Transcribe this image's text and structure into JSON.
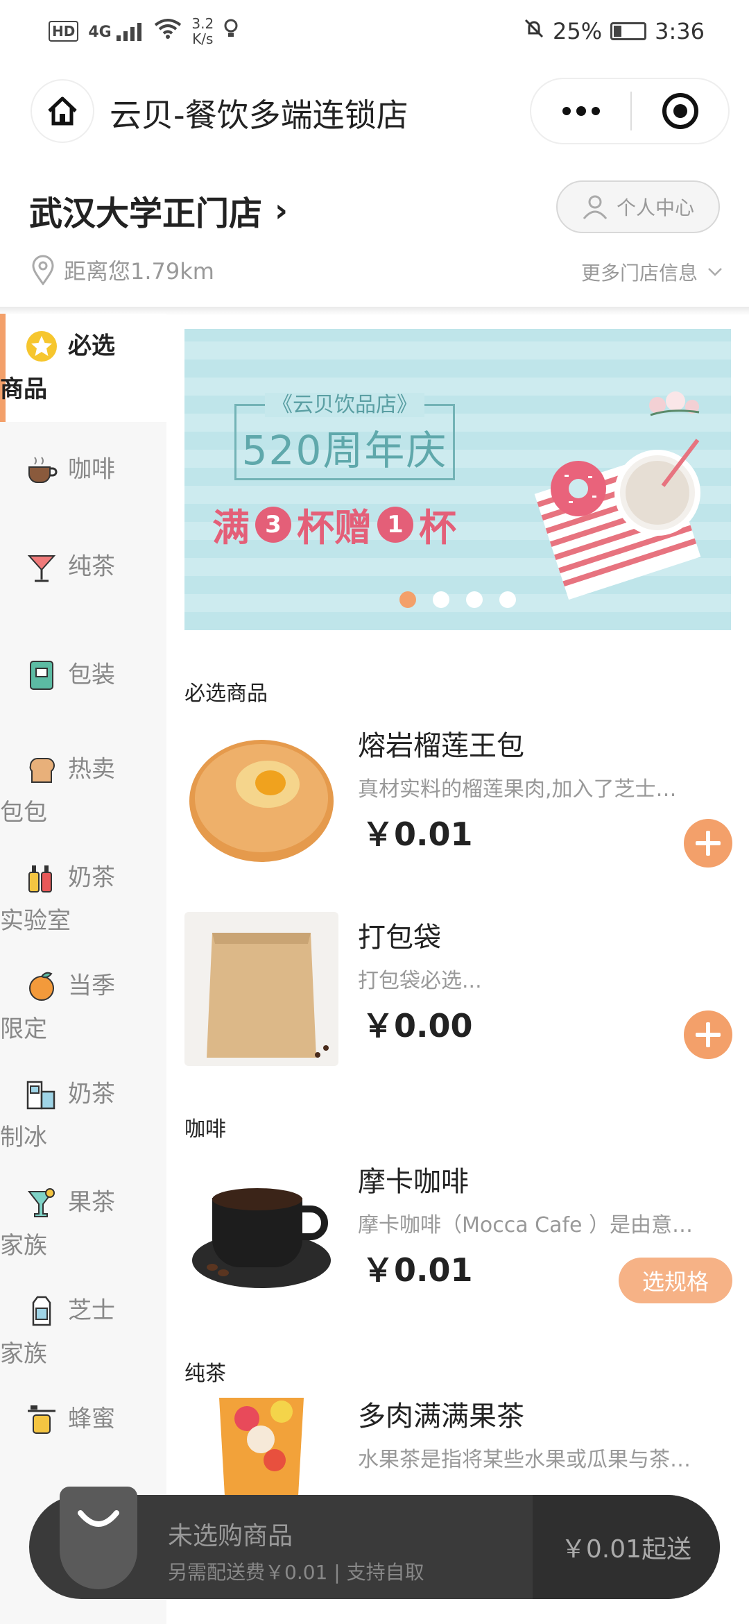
{
  "status_bar": {
    "hd": "HD",
    "signal": "4G",
    "speed_value": "3.2",
    "speed_unit": "K/s",
    "battery": "25%",
    "time": "3:36"
  },
  "title_bar": {
    "title": "云贝-餐饮多端连锁店"
  },
  "store": {
    "name": "武汉大学正门店",
    "user_center": "个人中心",
    "distance": "距离您1.79km",
    "more_info": "更多门店信息"
  },
  "sidebar": {
    "items": [
      {
        "label1": "必选",
        "label2": "商品",
        "icon": "star-icon"
      },
      {
        "label1": "咖啡",
        "label2": "",
        "icon": "coffee-cup-icon"
      },
      {
        "label1": "纯茶",
        "label2": "",
        "icon": "cocktail-glass-icon"
      },
      {
        "label1": "包装",
        "label2": "",
        "icon": "notebook-icon"
      },
      {
        "label1": "热卖",
        "label2": "包包",
        "icon": "bread-icon"
      },
      {
        "label1": "奶茶",
        "label2": "实验室",
        "icon": "bottles-icon"
      },
      {
        "label1": "当季",
        "label2": "限定",
        "icon": "orange-icon"
      },
      {
        "label1": "奶茶",
        "label2": "制冰",
        "icon": "ice-machine-icon"
      },
      {
        "label1": "果茶",
        "label2": "家族",
        "icon": "fruit-drink-icon"
      },
      {
        "label1": "芝士",
        "label2": "家族",
        "icon": "milk-carton-icon"
      },
      {
        "label1": "蜂蜜",
        "label2": "",
        "icon": "honey-jar-icon"
      }
    ]
  },
  "banner": {
    "subtitle": "《云贝饮品店》",
    "title": "520周年庆",
    "promo_a": "满",
    "promo_n1": "3",
    "promo_b": "杯赠",
    "promo_n2": "1",
    "promo_c": "杯",
    "slide_count": 4,
    "active_slide": 1
  },
  "sections": [
    {
      "title": "必选商品",
      "products": [
        {
          "name": "熔岩榴莲王包",
          "desc": "真材实料的榴莲果肉,加入了芝士…",
          "price": "￥0.01",
          "action": "add"
        },
        {
          "name": "打包袋",
          "desc": "打包袋必选...",
          "price": "￥0.00",
          "action": "add"
        }
      ]
    },
    {
      "title": "咖啡",
      "products": [
        {
          "name": "摩卡咖啡",
          "desc": "摩卡咖啡（Mocca Cafe ）是由意…",
          "price": "￥0.01",
          "action_label": "选规格"
        }
      ]
    },
    {
      "title": "纯茶",
      "products": [
        {
          "name": "多肉满满果茶",
          "desc": "水果茶是指将某些水果或瓜果与茶…",
          "price": ""
        }
      ]
    }
  ],
  "cart": {
    "title": "未选购商品",
    "subtitle": "另需配送费￥0.01 | 支持自取",
    "min_order": "￥0.01起送"
  },
  "colors": {
    "accent": "#f3a06a",
    "cart_bg": "#3a3a3a"
  }
}
